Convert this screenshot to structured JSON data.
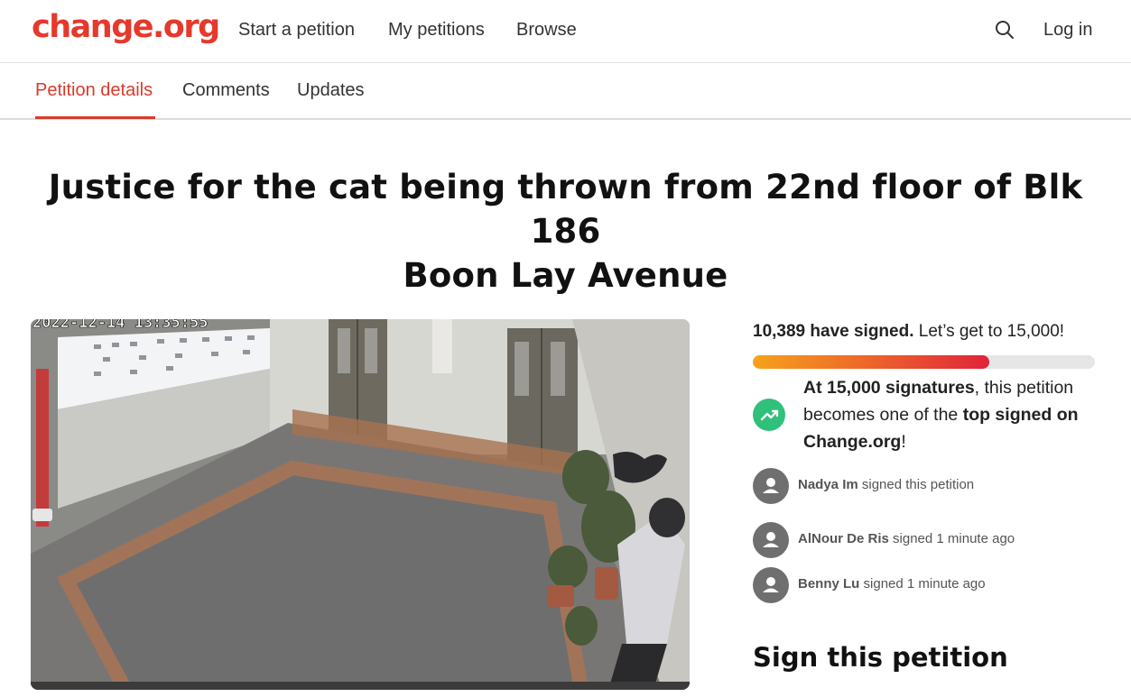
{
  "header": {
    "logo": "change.org",
    "nav": [
      "Start a petition",
      "My petitions",
      "Browse"
    ],
    "login": "Log in"
  },
  "tabs": [
    "Petition details",
    "Comments",
    "Updates"
  ],
  "active_tab": "Petition details",
  "petition": {
    "title_line1": "Justice for the cat being thrown from 22nd floor of Blk 186",
    "title_line2": "Boon Lay Avenue",
    "media_timestamp": "2022-12-14 13:35:55"
  },
  "progress": {
    "signed_count": "10,389 have signed.",
    "goal_text": "Let’s get to 15,000!",
    "fraction": 0.6926
  },
  "milestone": {
    "part1": "At 15,000 signatures",
    "part2": ", this petition becomes one of the ",
    "part3": "top signed",
    "part4": " ",
    "part5": "on Change.org",
    "part6": "!"
  },
  "recent_signers": [
    {
      "name": "Nadya Im",
      "action": "signed this petition"
    },
    {
      "name": "AlNour De Ris",
      "action": "signed 1 minute ago"
    },
    {
      "name": "Benny Lu",
      "action": "signed 1 minute ago"
    }
  ],
  "sign_heading": "Sign this petition",
  "colors": {
    "brand": "#e5392c",
    "tab_active": "#d93a2b",
    "milestone_green": "#2fc07a"
  },
  "icons": {
    "search": "search-icon",
    "milestone": "trending-up-icon",
    "avatar": "user-icon"
  }
}
